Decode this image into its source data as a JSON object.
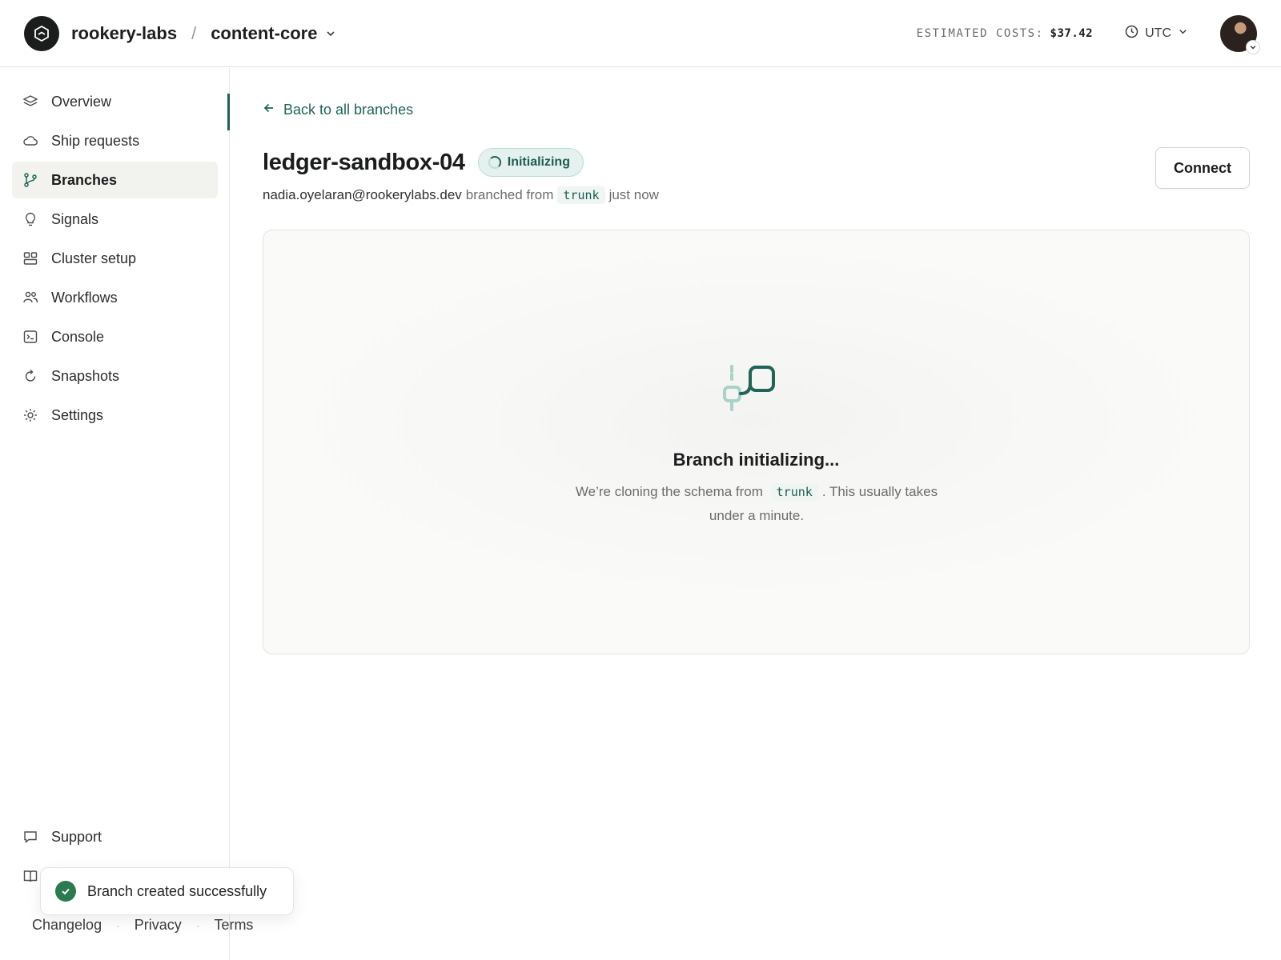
{
  "header": {
    "org": "rookery-labs",
    "separator": "/",
    "project": "content-core",
    "costs_label": "ESTIMATED COSTS:",
    "costs_value": "$37.42",
    "timezone": "UTC"
  },
  "sidebar": {
    "items": [
      {
        "label": "Overview",
        "icon": "layers-icon"
      },
      {
        "label": "Ship requests",
        "icon": "cloud-icon"
      },
      {
        "label": "Branches",
        "icon": "git-branch-icon",
        "active": true
      },
      {
        "label": "Signals",
        "icon": "lightbulb-icon"
      },
      {
        "label": "Cluster setup",
        "icon": "grid-icon"
      },
      {
        "label": "Workflows",
        "icon": "users-icon"
      },
      {
        "label": "Console",
        "icon": "terminal-icon"
      },
      {
        "label": "Snapshots",
        "icon": "refresh-icon"
      },
      {
        "label": "Settings",
        "icon": "gear-icon"
      }
    ],
    "support": "Support",
    "footer": {
      "changelog": "Changelog",
      "privacy": "Privacy",
      "terms": "Terms"
    }
  },
  "toast": {
    "message": "Branch created successfully"
  },
  "main": {
    "back_label": "Back to all branches",
    "branch_name": "ledger-sandbox-04",
    "status": "Initializing",
    "author": "nadia.oyelaran@rookerylabs.dev",
    "branched_from_text": "branched from",
    "parent_branch": "trunk",
    "time_text": "just now",
    "connect_label": "Connect",
    "panel": {
      "title": "Branch initializing...",
      "desc_before": "We’re cloning the schema from",
      "desc_code": "trunk",
      "desc_after": ". This usually takes under a minute."
    }
  },
  "colors": {
    "accent": "#1f6457",
    "badge_bg": "#e4f1ee",
    "success": "#2c7a4f"
  }
}
